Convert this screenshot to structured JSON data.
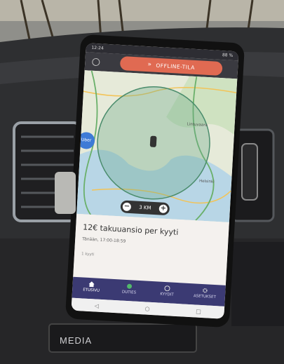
{
  "status": {
    "time": "12:24",
    "battery": "88 %"
  },
  "top": {
    "offline_label": "OFFLINE-TILA"
  },
  "map": {
    "radius_label": "3 KM",
    "place_1": "Lintuvaara",
    "place_2": "Helsinki",
    "brand_badge": "Uber"
  },
  "card": {
    "title": "12€ takuuansio per kyyti",
    "subtitle": "Tänään, 17:00-18:59",
    "note": "1 kyyti"
  },
  "tabs": [
    {
      "label": "ETUSIVU",
      "icon": "home-icon"
    },
    {
      "label": "DUTIES",
      "icon": "badge-icon"
    },
    {
      "label": "KYYDIT",
      "icon": "ride-icon"
    },
    {
      "label": "ASETUKSET",
      "icon": "gear-icon"
    }
  ],
  "android_nav": {
    "back": "◁",
    "home": "○",
    "recent": "□"
  },
  "car": {
    "media_label": "MEDIA"
  },
  "colors": {
    "offline": "#e06a52",
    "tabbar": "#3b3a73",
    "circle": "#6aa889"
  }
}
